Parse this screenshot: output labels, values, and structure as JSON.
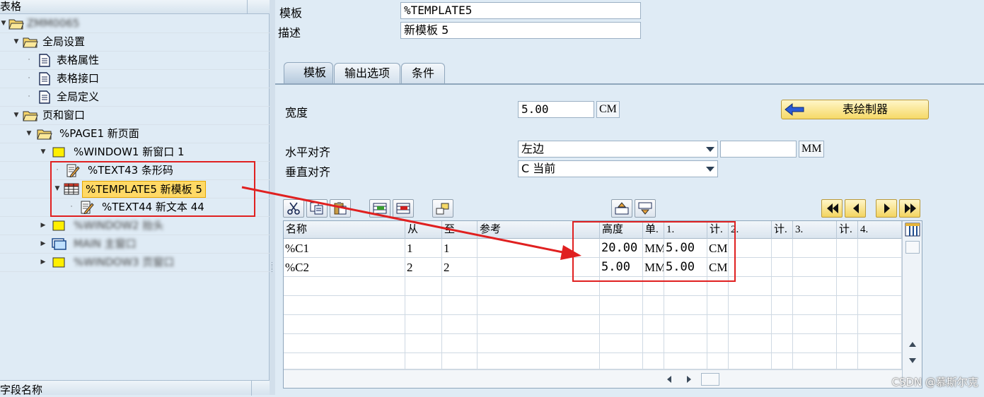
{
  "tree": {
    "header": "表格",
    "footer": "字段名称",
    "rows": [
      {
        "label": "ZMM0065",
        "blurred": true
      },
      {
        "label": "全局设置"
      },
      {
        "label": "表格属性"
      },
      {
        "label": "表格接口"
      },
      {
        "label": "全局定义"
      },
      {
        "label": "页和窗口"
      },
      {
        "label": "%PAGE1 新页面"
      },
      {
        "label": "%WINDOW1 新窗口 1"
      },
      {
        "label": "%TEXT43 条形码"
      },
      {
        "label": "%TEMPLATE5 新模板 5"
      },
      {
        "label": "%TEXT44 新文本 44"
      },
      {
        "label": "%WINDOW2 抬头",
        "blurred": true,
        "visible_part": "抬头"
      },
      {
        "label": "MAIN 主窗口",
        "blurred": true
      },
      {
        "label": "%WINDOW3 页窗口",
        "blurred": true
      }
    ]
  },
  "form": {
    "template_label": "模板",
    "template_value": "%TEMPLATE5",
    "desc_label": "描述",
    "desc_value": "新模板 5"
  },
  "tabs": [
    {
      "label": "模板",
      "active": true
    },
    {
      "label": "输出选项",
      "active": false
    },
    {
      "label": "条件",
      "active": false
    }
  ],
  "template_tab": {
    "width_label": "宽度",
    "width_value": "5.00",
    "width_unit": "CM",
    "draw_button": "表绘制器",
    "halign_label": "水平对齐",
    "halign_value": "左边",
    "halign_offset": "",
    "halign_unit": "MM",
    "valign_label": "垂直对齐",
    "valign_value": "C 当前"
  },
  "grid": {
    "headers": [
      "名称",
      "从",
      "至",
      "参考",
      "高度",
      "单.",
      "1.",
      "计.",
      "2.",
      "计.",
      "3.",
      "计.",
      "4."
    ],
    "rows": [
      [
        "%C1",
        "1",
        "1",
        "",
        "20.00",
        "MM",
        "5.00",
        "CM",
        "",
        "",
        "",
        "",
        ""
      ],
      [
        "%C2",
        "2",
        "2",
        "",
        "5.00",
        "MM",
        "5.00",
        "CM",
        "",
        "",
        "",
        "",
        ""
      ]
    ]
  },
  "watermark": "CSDN @慕斯尔克",
  "colors": {
    "annotation": "#e02020",
    "selection": "#ffd966",
    "background": "#dfebf5"
  }
}
